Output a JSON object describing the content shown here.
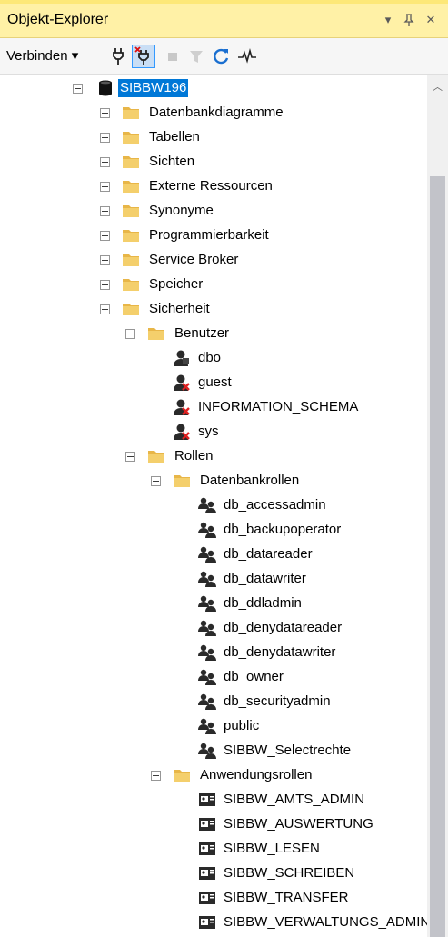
{
  "panel": {
    "title": "Objekt-Explorer",
    "controls": [
      "▾",
      "ᚹ",
      "✕"
    ]
  },
  "toolbar": {
    "connect_label": "Verbinden ▾",
    "buttons": [
      "connect-plug-icon",
      "disconnect-plug-icon",
      "stop-icon",
      "filter-icon",
      "refresh-icon",
      "activity-monitor-icon"
    ]
  },
  "colors": {
    "title_bg": "#fff1a6",
    "selection": "#0078d7",
    "folder": "#e8b648"
  },
  "tree": {
    "server": "SIBBW196",
    "db_folders": [
      "Datenbankdiagramme",
      "Tabellen",
      "Sichten",
      "Externe Ressourcen",
      "Synonyme",
      "Programmierbarkeit",
      "Service Broker",
      "Speicher"
    ],
    "security": "Sicherheit",
    "users_folder": "Benutzer",
    "users": [
      "dbo",
      "guest",
      "INFORMATION_SCHEMA",
      "sys"
    ],
    "roles_folder": "Rollen",
    "db_roles_folder": "Datenbankrollen",
    "db_roles": [
      "db_accessadmin",
      "db_backupoperator",
      "db_datareader",
      "db_datawriter",
      "db_ddladmin",
      "db_denydatareader",
      "db_denydatawriter",
      "db_owner",
      "db_securityadmin",
      "public",
      "SIBBW_Selectrechte"
    ],
    "app_roles_folder": "Anwendungsrollen",
    "app_roles": [
      "SIBBW_AMTS_ADMIN",
      "SIBBW_AUSWERTUNG",
      "SIBBW_LESEN",
      "SIBBW_SCHREIBEN",
      "SIBBW_TRANSFER",
      "SIBBW_VERWALTUNGS_ADMIN"
    ]
  }
}
